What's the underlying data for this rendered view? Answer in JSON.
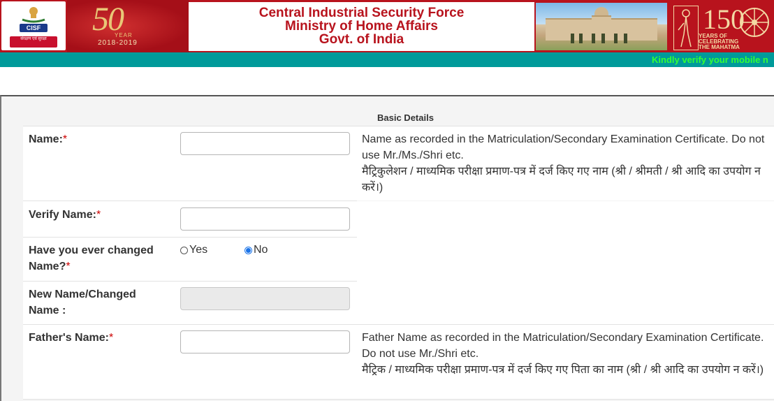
{
  "header": {
    "logo_text": "CISF",
    "logo_motto": "संरक्षण एवं सुरक्षा",
    "anniversary": {
      "number": "50",
      "year_label": "YEAR",
      "range": "2018-2019"
    },
    "title_lines": [
      "Central Industrial Security Force",
      "Ministry of Home Affairs",
      "Govt. of India"
    ],
    "gandhi": {
      "number": "150",
      "caption_lines": [
        "YEARS OF",
        "CELEBRATING",
        "THE MAHATMA"
      ]
    }
  },
  "ticker": {
    "text": "Kindly verify your mobile n"
  },
  "form": {
    "section_title": "Basic Details",
    "name": {
      "label": "Name:",
      "required": "*",
      "value": "",
      "help_en": "Name as recorded in the Matriculation/Secondary Examination Certificate. Do not use Mr./Ms./Shri etc.",
      "help_hi": "मैट्रिकुलेशन / माध्यमिक परीक्षा प्रमाण-पत्र में दर्ज किए गए नाम (श्री / श्रीमती / श्री आदि का उपयोग न करें।)"
    },
    "verify_name": {
      "label": "Verify Name:",
      "required": "*",
      "value": ""
    },
    "changed_name": {
      "label": "Have you ever changed Name?",
      "required": "*",
      "options": [
        "Yes",
        "No"
      ],
      "selected": "No"
    },
    "new_name": {
      "label": "New Name/Changed Name :",
      "value": ""
    },
    "father_name": {
      "label": "Father's Name:",
      "required": "*",
      "value": "",
      "help_en": "Father Name as recorded in the Matriculation/Secondary Examination Certificate. Do not use Mr./Shri etc.",
      "help_hi": "मैट्रिक / माध्यमिक परीक्षा प्रमाण-पत्र में दर्ज किए गए पिता का नाम (श्री / श्री आदि का उपयोग न करें।)"
    }
  },
  "colors": {
    "banner_red": "#b8131d",
    "ticker_teal": "#009a9a",
    "ticker_text": "#33ff33",
    "required_red": "#cc0000"
  },
  "icons": [
    "cisf-emblem-icon",
    "charkha-wheel-icon",
    "gandhi-silhouette-icon"
  ]
}
